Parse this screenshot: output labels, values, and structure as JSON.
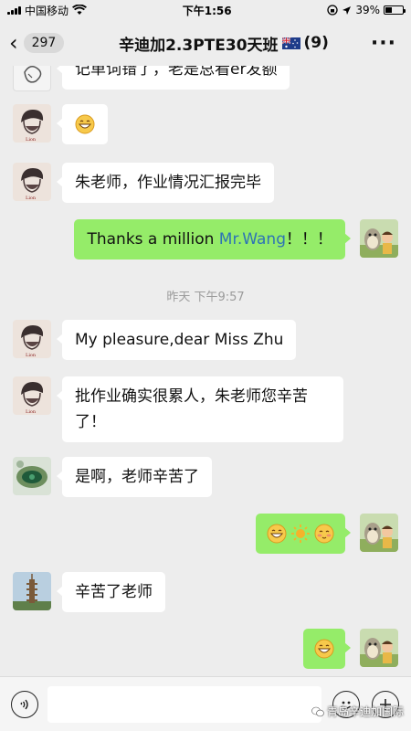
{
  "status_bar": {
    "carrier": "中国移动",
    "time": "下午1:56",
    "battery_percent": "39%",
    "battery_level": 0.39
  },
  "nav": {
    "unread_count": "297",
    "title": "辛迪加2.3PTE30天班",
    "member_count": "(9)",
    "flag_icon": "australia-flag-icon",
    "more_icon": "more-dots-icon"
  },
  "messages": [
    {
      "side": "left",
      "avatar": "avatar-partial",
      "text": "记单词错了，老是总看er发额"
    },
    {
      "side": "left",
      "avatar": "avatar-lion",
      "emoji": [
        "grin-emoji"
      ]
    },
    {
      "side": "left",
      "avatar": "avatar-lion",
      "text": "朱老师，作业情况汇报完毕"
    },
    {
      "side": "right",
      "avatar": "avatar-totoro",
      "text_pre": "Thanks a million ",
      "mention": "Mr.Wang",
      "text_post": "！！！"
    },
    {
      "timestamp": "昨天 下午9:57"
    },
    {
      "side": "left",
      "avatar": "avatar-lion",
      "text": "My pleasure,dear Miss Zhu"
    },
    {
      "side": "left",
      "avatar": "avatar-lion",
      "text_line1": "批作业确实很累人，朱老师您辛苦",
      "text_line2": "了！"
    },
    {
      "side": "left",
      "avatar": "avatar-pond",
      "text": "是啊，老师辛苦了"
    },
    {
      "side": "right",
      "avatar": "avatar-totoro",
      "emoji": [
        "grin-emoji",
        "sun-emoji",
        "shy-emoji"
      ]
    },
    {
      "side": "left",
      "avatar": "avatar-pagoda",
      "text": "辛苦了老师"
    },
    {
      "side": "right",
      "avatar": "avatar-totoro",
      "emoji": [
        "grin-emoji"
      ]
    }
  ],
  "input_bar": {
    "voice_icon": "voice-icon",
    "emoji_icon": "emoji-icon",
    "plus_icon": "plus-icon",
    "placeholder": ""
  },
  "watermark": "青岛辛迪加国际",
  "colors": {
    "background": "#ededed",
    "bubble_left": "#ffffff",
    "bubble_right": "#95ec69",
    "mention": "#2e74b5",
    "timestamp": "#9b9b9b"
  }
}
